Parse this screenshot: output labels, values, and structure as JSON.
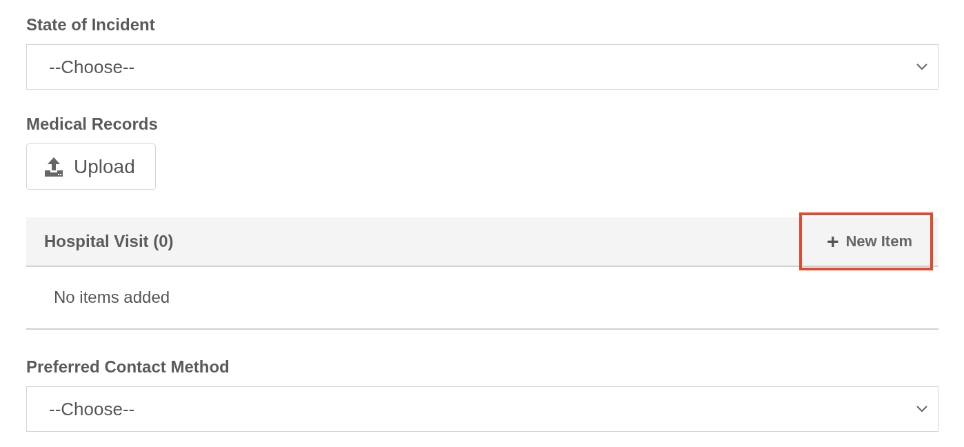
{
  "fields": [
    {
      "kind": "select",
      "label": "State of Incident",
      "value": "--Choose--"
    },
    {
      "kind": "upload",
      "label": "Medical Records",
      "button": "Upload"
    },
    {
      "kind": "section",
      "title": "Hospital Visit (0)",
      "action": {
        "label": "New Item",
        "icon": "+",
        "highlighted": true
      },
      "empty_text": "No items added"
    },
    {
      "kind": "select",
      "label": "Preferred Contact Method",
      "value": "--Choose--"
    }
  ]
}
